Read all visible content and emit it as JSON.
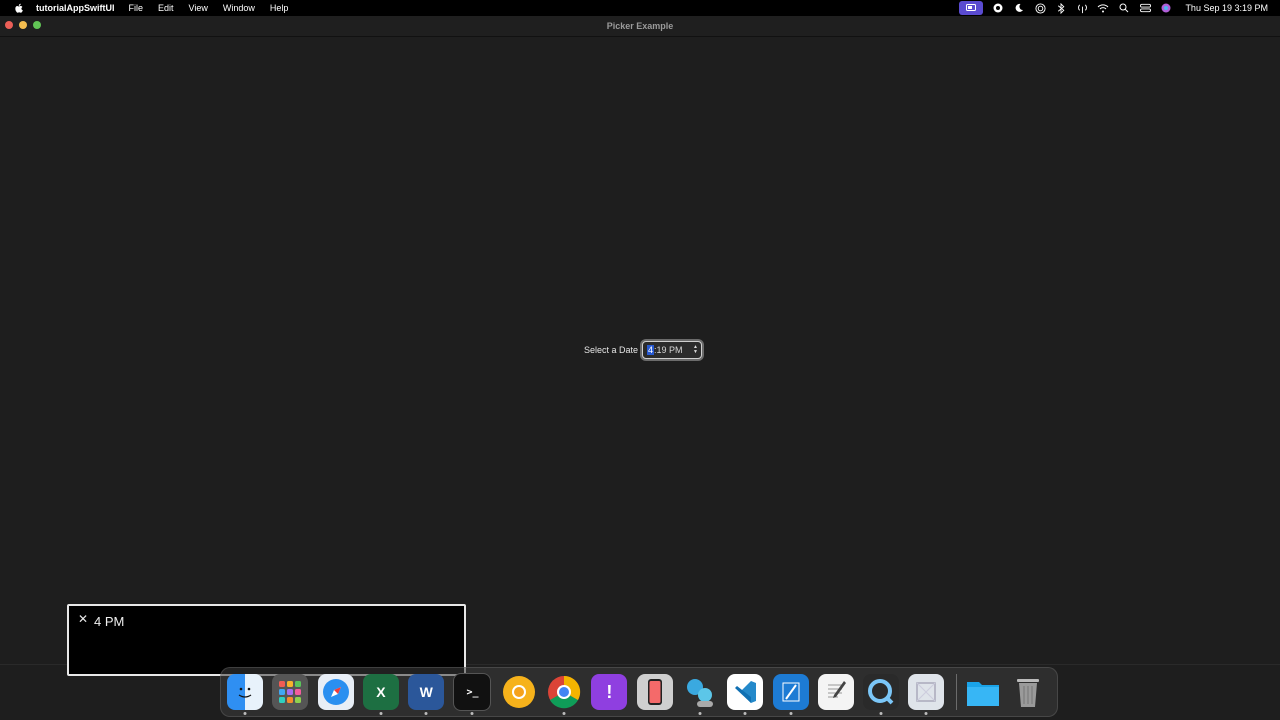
{
  "menubar": {
    "app_name": "tutorialAppSwiftUI",
    "menus": [
      "File",
      "Edit",
      "View",
      "Window",
      "Help"
    ],
    "clock": "Thu Sep 19  3:19 PM"
  },
  "window": {
    "title": "Picker Example"
  },
  "picker": {
    "label": "Select a Date",
    "hour": "4",
    "rest": ":19 PM"
  },
  "caption": {
    "close_glyph": "✕",
    "text": "4 PM"
  },
  "dock": {
    "apps": [
      "Finder",
      "Launchpad",
      "Safari",
      "Excel",
      "Word",
      "Terminal",
      "Chrome Canary",
      "Chrome",
      "Feedback Assistant",
      "Simulator",
      "Xcode Beta",
      "VS Code",
      "Xcode",
      "TextEdit",
      "QuickTime",
      "Preview",
      "Downloads",
      "Trash"
    ]
  },
  "colors": {
    "accent": "#2759d1",
    "window_bg": "#1e1e1e"
  }
}
